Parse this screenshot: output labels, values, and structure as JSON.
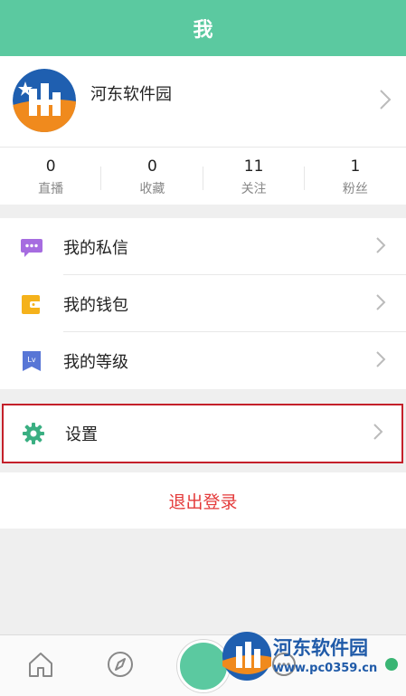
{
  "header": {
    "title": "我"
  },
  "profile": {
    "username": "河东软件园",
    "stats": [
      {
        "value": "0",
        "label": "直播"
      },
      {
        "value": "0",
        "label": "收藏"
      },
      {
        "value": "11",
        "label": "关注"
      },
      {
        "value": "1",
        "label": "粉丝"
      }
    ]
  },
  "menu": {
    "messages": "我的私信",
    "wallet": "我的钱包",
    "level": "我的等级",
    "settings": "设置"
  },
  "logout": "退出登录",
  "colors": {
    "accent": "#5bc9a0",
    "logout": "#e43a3a",
    "highlight_border": "#c4202a",
    "watermark": "#1f5aa8"
  },
  "watermark": {
    "name": "河东软件园",
    "url": "www.pc0359.cn"
  }
}
